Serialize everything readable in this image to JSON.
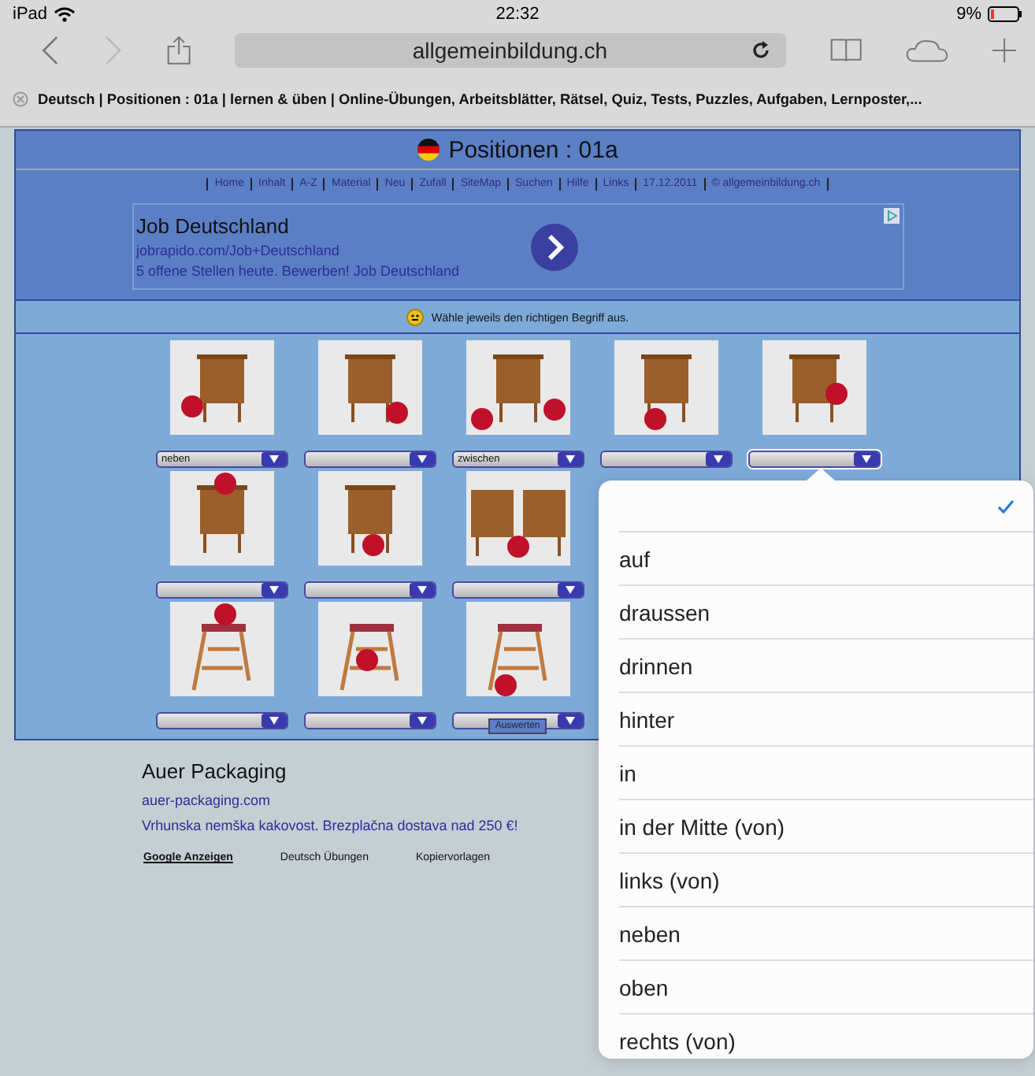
{
  "status_bar": {
    "device": "iPad",
    "time": "22:32",
    "battery": "9%"
  },
  "toolbar": {
    "address": "allgemeinbildung.ch"
  },
  "page_title": "Deutsch | Positionen : 01a | lernen & üben | Online-Übungen, Arbeitsblätter, Rätsel, Quiz, Tests, Puzzles, Aufgaben, Lernposter,...",
  "header": {
    "title": "Positionen : 01a"
  },
  "nav_links": [
    "Home",
    "Inhalt",
    "A-Z",
    "Material",
    "Neu",
    "Zufall",
    "SiteMap",
    "Suchen",
    "Hilfe",
    "Links",
    "17.12.2011",
    "© allgemeinbildung.ch"
  ],
  "ad_top": {
    "title": "Job Deutschland",
    "url": "jobrapido.com/Job+Deutschland",
    "text": "5 offene Stellen heute. Bewerben! Job Deutschland"
  },
  "instruction": "Wähle jeweils den richtigen Begriff aus.",
  "rows": [
    {
      "cells": [
        {
          "kind": "picture",
          "value": "neben",
          "open": false
        },
        {
          "kind": "picture",
          "open": false
        },
        {
          "kind": "picture",
          "value": "zwischen",
          "open": false
        },
        {
          "kind": "picture",
          "open": false
        },
        {
          "kind": "picture",
          "open": true
        }
      ]
    },
    {
      "cells": [
        {
          "kind": "picture",
          "open": false
        },
        {
          "kind": "picture",
          "open": false
        },
        {
          "kind": "picture",
          "open": false
        }
      ]
    },
    {
      "cells": [
        {
          "kind": "picture",
          "open": false
        },
        {
          "kind": "picture",
          "open": false
        },
        {
          "kind": "picture",
          "open": false
        }
      ]
    }
  ],
  "submit_button": "Auswerten",
  "ad_bottom": {
    "title": "Auer Packaging",
    "url": "auer-packaging.com",
    "text": "Vrhunska nemška kakovost. Brezplačna dostava nad 250 €!"
  },
  "footer_links": [
    "Google Anzeigen",
    "Deutsch Übungen",
    "Kopiervorlagen"
  ],
  "picker": {
    "blank_selected": true,
    "options": [
      {
        "label": "auf",
        "selected": false
      },
      {
        "label": "draussen",
        "selected": false
      },
      {
        "label": "drinnen",
        "selected": false
      },
      {
        "label": "hinter",
        "selected": false
      },
      {
        "label": "in",
        "selected": false
      },
      {
        "label": "in der Mitte (von)",
        "selected": false
      },
      {
        "label": "links (von)",
        "selected": false
      },
      {
        "label": "neben",
        "selected": false
      },
      {
        "label": "oben",
        "selected": false
      },
      {
        "label": "rechts (von)",
        "selected": false
      }
    ]
  }
}
